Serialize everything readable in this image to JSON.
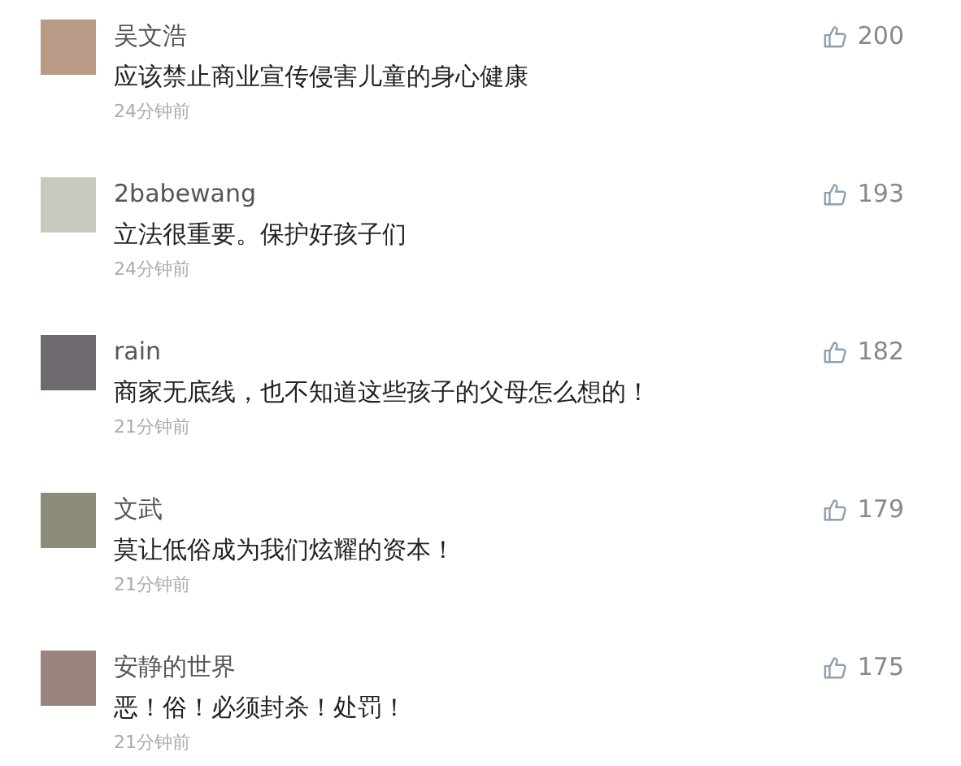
{
  "comments": [
    {
      "name": "吴文浩",
      "text": "应该禁止商业宣传侵害儿童的身心健康",
      "time": "24分钟前",
      "likes": "200"
    },
    {
      "name": "2babewang",
      "text": "立法很重要。保护好孩子们",
      "time": "24分钟前",
      "likes": "193"
    },
    {
      "name": "rain",
      "text": "商家无底线，也不知道这些孩子的父母怎么想的！",
      "time": "21分钟前",
      "likes": "182"
    },
    {
      "name": "文武",
      "text": "莫让低俗成为我们炫耀的资本！",
      "time": "21分钟前",
      "likes": "179"
    },
    {
      "name": "安静的世界",
      "text": "恶！俗！必须封杀！处罚！",
      "time": "21分钟前",
      "likes": "175"
    }
  ]
}
